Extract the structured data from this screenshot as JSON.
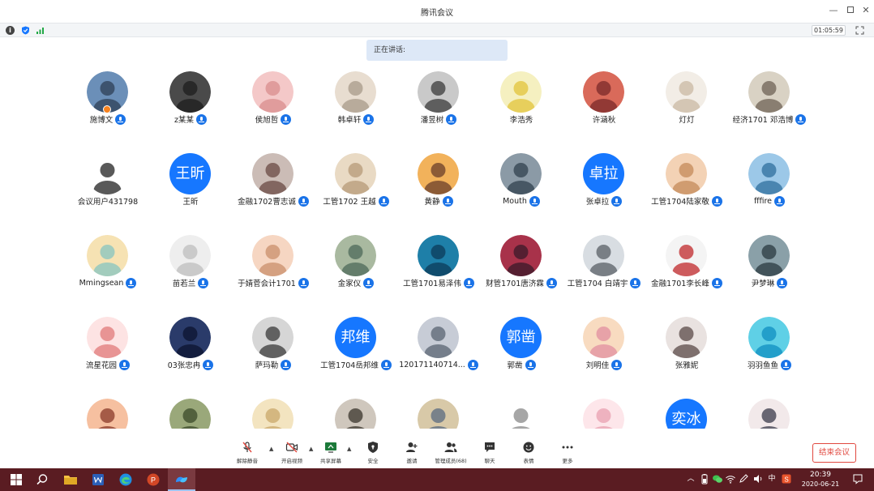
{
  "window": {
    "title": "腾讯会议"
  },
  "status": {
    "timer": "01:05:59"
  },
  "speaking": {
    "label": "正在讲话:"
  },
  "colors": {
    "accent": "#1677ff",
    "mic": "#1a73e8",
    "end": "#e1483f",
    "taskbar": "#5a1c22",
    "banner": "#dde8f7"
  },
  "participants": [
    {
      "name": "施博文",
      "avatar_text": "",
      "mic": true,
      "host": true
    },
    {
      "name": "z某某",
      "avatar_text": "",
      "mic": true
    },
    {
      "name": "侯旭哲",
      "avatar_text": "",
      "mic": true
    },
    {
      "name": "韩卓轩",
      "avatar_text": "",
      "mic": true
    },
    {
      "name": "潘昱树",
      "avatar_text": "",
      "mic": true
    },
    {
      "name": "李浩秀",
      "avatar_text": "",
      "mic": false
    },
    {
      "name": "许涵秋",
      "avatar_text": "",
      "mic": false
    },
    {
      "name": "灯灯",
      "avatar_text": "",
      "mic": false
    },
    {
      "name": "经济1701 邓浩博",
      "avatar_text": "",
      "mic": true
    },
    {
      "name": "会议用户431798",
      "avatar_text": "",
      "mic": false
    },
    {
      "name": "王昕",
      "avatar_text": "王昕",
      "mic": false
    },
    {
      "name": "金融1702曹志诚",
      "avatar_text": "",
      "mic": true
    },
    {
      "name": "工管1702 王越",
      "avatar_text": "",
      "mic": true
    },
    {
      "name": "黄静",
      "avatar_text": "",
      "mic": true
    },
    {
      "name": "Mouth",
      "avatar_text": "",
      "mic": true
    },
    {
      "name": "张卓拉",
      "avatar_text": "卓拉",
      "mic": true
    },
    {
      "name": "工管1704陆家敬",
      "avatar_text": "",
      "mic": true
    },
    {
      "name": "fffire",
      "avatar_text": "",
      "mic": true
    },
    {
      "name": "Mmingsean",
      "avatar_text": "",
      "mic": true
    },
    {
      "name": "苗若兰",
      "avatar_text": "",
      "mic": true
    },
    {
      "name": "于婧菅会计1701",
      "avatar_text": "",
      "mic": true
    },
    {
      "name": "金家仪",
      "avatar_text": "",
      "mic": true
    },
    {
      "name": "工管1701易泽伟",
      "avatar_text": "",
      "mic": true
    },
    {
      "name": "财管1701唐济霖",
      "avatar_text": "",
      "mic": true
    },
    {
      "name": "工管1704 白靖宇",
      "avatar_text": "",
      "mic": true
    },
    {
      "name": "金融1701李长峰",
      "avatar_text": "",
      "mic": true
    },
    {
      "name": "尹梦琳",
      "avatar_text": "",
      "mic": true
    },
    {
      "name": "流星花园",
      "avatar_text": "",
      "mic": true
    },
    {
      "name": "03张忠冉",
      "avatar_text": "",
      "mic": true
    },
    {
      "name": "萨玛勒",
      "avatar_text": "",
      "mic": true
    },
    {
      "name": "工管1704岳邦维",
      "avatar_text": "邦维",
      "mic": true
    },
    {
      "name": "120171140714...",
      "avatar_text": "",
      "mic": true
    },
    {
      "name": "郭凿",
      "avatar_text": "郭凿",
      "mic": true
    },
    {
      "name": "刘明佳",
      "avatar_text": "",
      "mic": true
    },
    {
      "name": "张雅妮",
      "avatar_text": "",
      "mic": false
    },
    {
      "name": "羽羽鱼鱼",
      "avatar_text": "",
      "mic": true
    },
    {
      "name": "",
      "avatar_text": "",
      "mic": false
    },
    {
      "name": "",
      "avatar_text": "",
      "mic": false
    },
    {
      "name": "",
      "avatar_text": "",
      "mic": false
    },
    {
      "name": "",
      "avatar_text": "",
      "mic": false
    },
    {
      "name": "",
      "avatar_text": "",
      "mic": false
    },
    {
      "name": "",
      "avatar_text": "",
      "mic": false
    },
    {
      "name": "",
      "avatar_text": "",
      "mic": false
    },
    {
      "name": "",
      "avatar_text": "奕冰",
      "mic": false
    },
    {
      "name": "",
      "avatar_text": "",
      "mic": false
    }
  ],
  "toolbar": {
    "unmute": "解除静音",
    "video": "开启视频",
    "share": "共享屏幕",
    "security": "安全",
    "invite": "邀请",
    "members": "管理成员(68)",
    "chat": "聊天",
    "reactions": "表情",
    "more": "更多",
    "end": "结束会议"
  },
  "taskbar": {
    "time": "20:39",
    "date": "2020-06-21",
    "ime": "中"
  }
}
